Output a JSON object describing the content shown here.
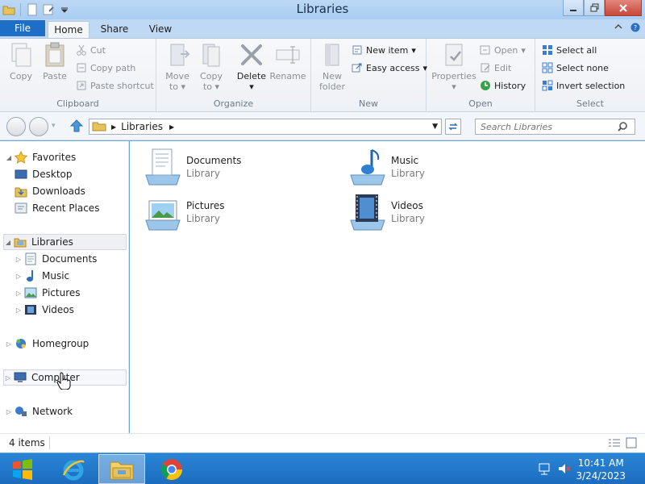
{
  "window": {
    "title": "Libraries"
  },
  "tabs": {
    "file": "File",
    "home": "Home",
    "share": "Share",
    "view": "View"
  },
  "ribbon": {
    "clipboard": {
      "label": "Clipboard",
      "copy": "Copy",
      "paste": "Paste",
      "cut": "Cut",
      "copy_path": "Copy path",
      "paste_shortcut": "Paste shortcut"
    },
    "organize": {
      "label": "Organize",
      "move_to_1": "Move",
      "move_to_2": "to",
      "copy_to_1": "Copy",
      "copy_to_2": "to",
      "delete": "Delete",
      "rename": "Rename"
    },
    "new": {
      "label": "New",
      "new_folder_1": "New",
      "new_folder_2": "folder",
      "new_item": "New item",
      "easy_access": "Easy access"
    },
    "open": {
      "label": "Open",
      "properties": "Properties",
      "open": "Open",
      "edit": "Edit",
      "history": "History"
    },
    "select": {
      "label": "Select",
      "select_all": "Select all",
      "select_none": "Select none",
      "invert_selection": "Invert selection"
    }
  },
  "address": {
    "path": "Libraries",
    "search_placeholder": "Search Libraries"
  },
  "nav": {
    "favorites": "Favorites",
    "desktop": "Desktop",
    "downloads": "Downloads",
    "recent_places": "Recent Places",
    "libraries": "Libraries",
    "documents": "Documents",
    "music": "Music",
    "pictures": "Pictures",
    "videos": "Videos",
    "homegroup": "Homegroup",
    "computer": "Computer",
    "network": "Network"
  },
  "content": {
    "items": [
      {
        "name": "Documents",
        "type": "Library"
      },
      {
        "name": "Music",
        "type": "Library"
      },
      {
        "name": "Pictures",
        "type": "Library"
      },
      {
        "name": "Videos",
        "type": "Library"
      }
    ]
  },
  "status": {
    "count": "4 items"
  },
  "taskbar": {
    "time": "10:41 AM",
    "date": "3/24/2023"
  },
  "colors": {
    "file_tab": "#1d6ec6",
    "taskbar": "#1c6cbf",
    "close_button": "#c7463a"
  }
}
